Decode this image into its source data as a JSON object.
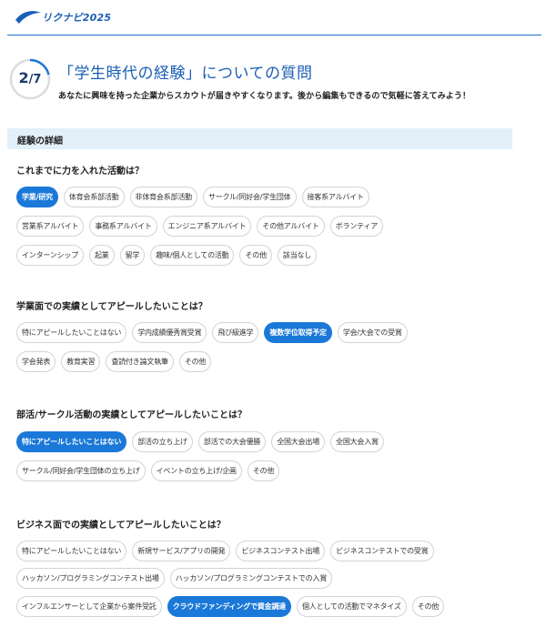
{
  "header": {
    "logo_text": "リクナビ2025"
  },
  "step": {
    "current": "2",
    "total": "7"
  },
  "title": "「学生時代の経験」についての質問",
  "subtitle": "あなたに興味を持った企業からスカウトが届きやすくなります。後から編集もできるので気軽に答えてみよう！",
  "section_title": "経験の詳細",
  "questions": [
    {
      "label": "これまでに力を入れた活動は？",
      "rows": [
        [
          {
            "label": "学業/研究",
            "selected": true
          },
          {
            "label": "体育会系部活動",
            "selected": false
          },
          {
            "label": "非体育会系部活動",
            "selected": false
          },
          {
            "label": "サークル/同好会/学生団体",
            "selected": false
          },
          {
            "label": "接客系アルバイト",
            "selected": false
          }
        ],
        [
          {
            "label": "営業系アルバイト",
            "selected": false
          },
          {
            "label": "事務系アルバイト",
            "selected": false
          },
          {
            "label": "エンジニア系アルバイト",
            "selected": false
          },
          {
            "label": "その他アルバイト",
            "selected": false
          },
          {
            "label": "ボランティア",
            "selected": false
          }
        ],
        [
          {
            "label": "インターンシップ",
            "selected": false
          },
          {
            "label": "起業",
            "selected": false
          },
          {
            "label": "留学",
            "selected": false
          },
          {
            "label": "趣味/個人としての活動",
            "selected": false
          },
          {
            "label": "その他",
            "selected": false
          },
          {
            "label": "該当なし",
            "selected": false
          }
        ]
      ]
    },
    {
      "label": "学業面での実績としてアピールしたいことは？",
      "rows": [
        [
          {
            "label": "特にアピールしたいことはない",
            "selected": false
          },
          {
            "label": "学内成績優秀賞受賞",
            "selected": false
          },
          {
            "label": "飛び級進学",
            "selected": false
          },
          {
            "label": "複数学位取得予定",
            "selected": true
          },
          {
            "label": "学会/大会での受賞",
            "selected": false
          }
        ],
        [
          {
            "label": "学会発表",
            "selected": false
          },
          {
            "label": "教育実習",
            "selected": false
          },
          {
            "label": "査読付き論文執筆",
            "selected": false
          },
          {
            "label": "その他",
            "selected": false
          }
        ]
      ]
    },
    {
      "label": "部活/サークル活動の実績としてアピールしたいことは？",
      "rows": [
        [
          {
            "label": "特にアピールしたいことはない",
            "selected": true
          },
          {
            "label": "部活の立ち上げ",
            "selected": false
          },
          {
            "label": "部活での大会優勝",
            "selected": false
          },
          {
            "label": "全国大会出場",
            "selected": false
          },
          {
            "label": "全国大会入賞",
            "selected": false
          }
        ],
        [
          {
            "label": "サークル/同好会/学生団体の立ち上げ",
            "selected": false
          },
          {
            "label": "イベントの立ち上げ/企画",
            "selected": false
          },
          {
            "label": "その他",
            "selected": false
          }
        ]
      ]
    },
    {
      "label": "ビジネス面での実績としてアピールしたいことは？",
      "rows": [
        [
          {
            "label": "特にアピールしたいことはない",
            "selected": false
          },
          {
            "label": "新規サービス/アプリの開発",
            "selected": false
          },
          {
            "label": "ビジネスコンテスト出場",
            "selected": false
          },
          {
            "label": "ビジネスコンテストでの受賞",
            "selected": false
          }
        ],
        [
          {
            "label": "ハッカソン/プログラミングコンテスト出場",
            "selected": false
          },
          {
            "label": "ハッカソン/プログラミングコンテストでの入賞",
            "selected": false
          }
        ],
        [
          {
            "label": "インフルエンサーとして企業から案件受託",
            "selected": false
          },
          {
            "label": "クラウドファンディングで資金調達",
            "selected": true
          },
          {
            "label": "個人としての活動でマネタイズ",
            "selected": false
          },
          {
            "label": "その他",
            "selected": false
          }
        ]
      ]
    }
  ],
  "colors": {
    "accent": "#1a78d8",
    "title": "#1a5fb4",
    "section_bg": "#e3f0fa"
  }
}
